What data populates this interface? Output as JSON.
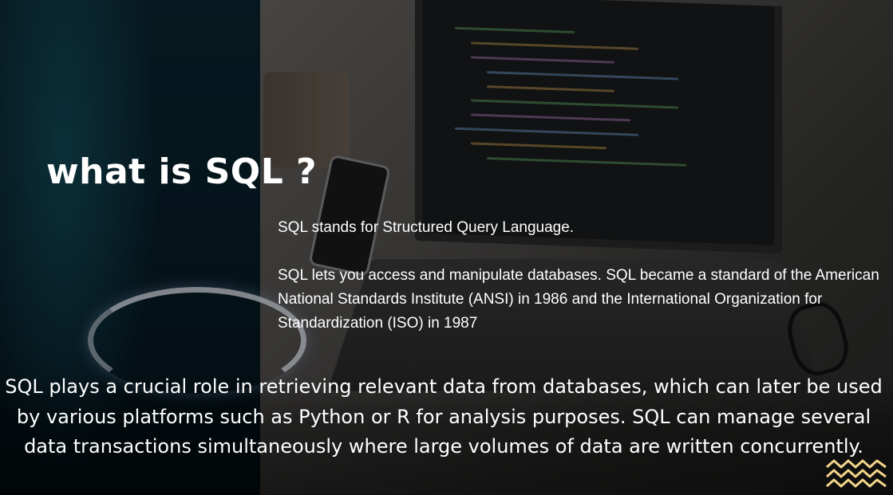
{
  "slide": {
    "title": "what is SQL ?",
    "paragraph_1": "SQL stands for Structured Query Language.",
    "paragraph_2": "SQL lets you access and manipulate databases. SQL became a standard of the American National Standards Institute (ANSI) in 1986 and the International Organization for Standardization (ISO) in 1987",
    "bottom_text": "SQL plays a crucial role in retrieving relevant data from databases, which can later be used by various platforms such as Python or R for analysis purposes. SQL can manage several data transactions simultaneously where large volumes of data are written concurrently."
  },
  "colors": {
    "text": "#ffffff",
    "left_panel": "#08202a",
    "accent_zigzag": "#f2d48a"
  },
  "icons": {
    "decoration": "zigzag-waves-icon"
  }
}
